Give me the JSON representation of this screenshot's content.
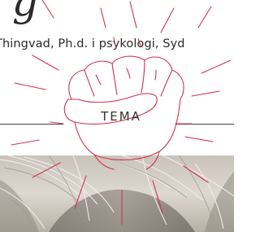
{
  "heading": {
    "fragment": "g"
  },
  "byline": {
    "text": "Thingvad, Ph.d. i psykologi, Syd"
  },
  "section": {
    "label": "TEMA"
  },
  "colors": {
    "accent": "#d2334a",
    "text": "#2a2a2a",
    "rule": "#444444",
    "hair": "#d7d3cc",
    "background": "#ffffff"
  },
  "icons": {
    "emblem": "fist-icon"
  }
}
